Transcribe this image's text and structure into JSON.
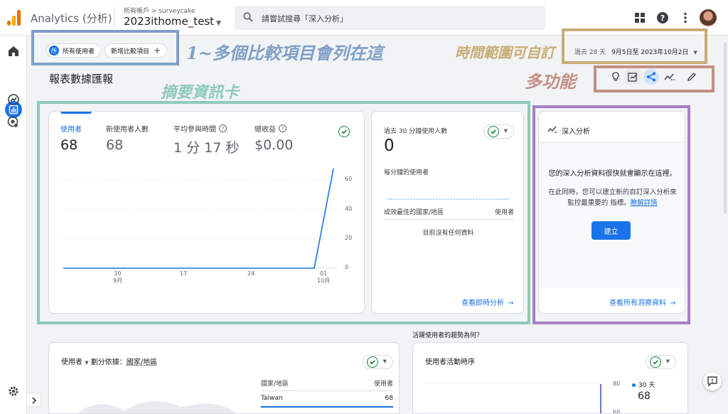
{
  "header": {
    "app_title": "Analytics (分析)",
    "account_crumb": "所有帳戶 > surveycake",
    "property_name": "2023ithome_test",
    "search_placeholder": "請嘗試搜尋「深入分析」",
    "icons": [
      "apps-grid-icon",
      "help-icon",
      "more-vert-icon",
      "avatar"
    ]
  },
  "left_nav": {
    "items": [
      "home-icon",
      "reports-icon",
      "explore-icon",
      "advertising-icon"
    ],
    "active": "reports-icon",
    "bottom": [
      "settings-icon",
      "expand-icon"
    ]
  },
  "filters": {
    "segment_icon_text": "所",
    "segment_label": "所有使用者",
    "add_comparison": "新增比較項目"
  },
  "date_range": {
    "preset": "過去 28 天",
    "range": "9月5日至 2023年10月2日"
  },
  "report": {
    "title": "報表數據匯報",
    "toolbar": [
      "insights-bulb-icon",
      "customize-report-icon",
      "share-icon",
      "compare-trend-icon",
      "edit-pencil-icon"
    ]
  },
  "annotations": {
    "comparison_note": "1~多個比較項目會列在這",
    "date_note": "時間範圍可自訂",
    "tools_note": "多功能",
    "summary_note": "摘要資訊卡"
  },
  "summary_card": {
    "metrics": [
      {
        "label": "使用者",
        "value": "68"
      },
      {
        "label": "新使用者人數",
        "value": "68"
      },
      {
        "label": "平均參與時間",
        "value": "1 分 17 秒"
      },
      {
        "label": "總收益",
        "value": "$0.00"
      }
    ],
    "status": "check-circle-icon"
  },
  "chart_data": {
    "type": "line",
    "x": [
      "9/5",
      "9/10",
      "9/17",
      "9/24",
      "10/1",
      "10/2"
    ],
    "x_tick_labels": [
      {
        "day": "10",
        "month": "9月"
      },
      {
        "day": "17",
        "month": ""
      },
      {
        "day": "24",
        "month": ""
      },
      {
        "day": "01",
        "month": "10月"
      }
    ],
    "series": [
      {
        "values": [
          0,
          0,
          0,
          0,
          0,
          68
        ]
      }
    ],
    "y_ticks": [
      "60",
      "40",
      "20",
      "0"
    ],
    "ylim": [
      0,
      68
    ],
    "color": "#1a73e8"
  },
  "realtime_card": {
    "title": "過去 30 分鐘使用人數",
    "value": "0",
    "per_minute_label": "每分鐘的使用者",
    "col_country": "成效最佳的國家/地區",
    "col_users": "使用者",
    "empty": "目前沒有任何資料",
    "link": "查看即時分析"
  },
  "insights_card": {
    "title": "深入分析",
    "message": "您的深入分析資料很快就會顯示在這裡。",
    "sub": "在此同時，您可以建立新的自訂深入分析來監控最重要的 指標。",
    "sub_link": "瞭解詳情",
    "button": "建立",
    "link": "查看所有洞察資料"
  },
  "trend_question": "活躍使用者的趨勢為何？",
  "geo_card": {
    "metric": "使用者",
    "dim_prefix": "劃分依據：",
    "dim": "國家/地區",
    "col_country": "國家/地區",
    "col_users": "使用者",
    "row_country": "Taiwan",
    "row_users": "68"
  },
  "activity_card": {
    "title": "使用者活動時序",
    "y_ticks": [
      "80",
      "60"
    ],
    "legend": "30 天",
    "legend_value": "68"
  },
  "colors": {
    "accent": "#1a73e8",
    "ann_blue": "#7f9fc6",
    "ann_gold": "#c9ad75",
    "ann_rose": "#c48f86",
    "ann_teal": "#8fcab8",
    "ann_purple": "#a87ec7"
  }
}
